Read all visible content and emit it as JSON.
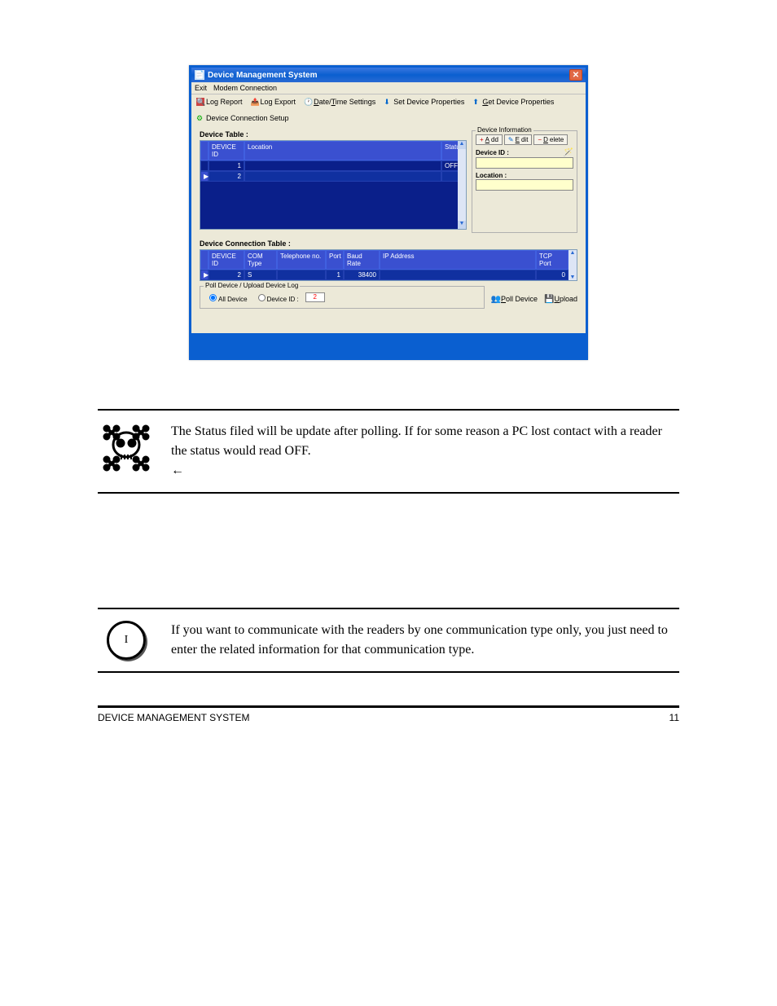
{
  "window": {
    "title": "Device Management System",
    "menu": {
      "item1": "Exit",
      "item2": "Modem Connection"
    },
    "toolbar": {
      "log_report": "Log Report",
      "log_export": "Log Export",
      "date_time": "Date/Time Settings",
      "set_props": "Set Device Properties",
      "get_props": "Get Device Properties",
      "conn_setup": "Device Connection Setup"
    },
    "device_table": {
      "label": "Device Table :",
      "headers": {
        "id": "DEVICE ID",
        "location": "Location",
        "status": "Status"
      },
      "rows": [
        {
          "id": "1",
          "status": "OFF"
        },
        {
          "id": "2",
          "status": ""
        }
      ]
    },
    "device_info": {
      "legend": "Device Information",
      "add": "Add",
      "edit": "Edit",
      "delete": "Delete",
      "id_label": "Device ID :",
      "loc_label": "Location :"
    },
    "conn_table": {
      "label": "Device Connection Table :",
      "headers": {
        "id": "DEVICE ID",
        "com": "COM Type",
        "tel": "Telephone no.",
        "port": "Port",
        "baud": "Baud Rate",
        "ip": "IP Address",
        "tcp": "TCP Port"
      },
      "row": {
        "id": "2",
        "com": "S",
        "port": "1",
        "baud": "38400",
        "tcp": "0"
      }
    },
    "poll": {
      "legend": "Poll Device / Upload Device Log",
      "all": "All Device",
      "did": "Device ID :",
      "did_val": "2",
      "poll_btn": "Poll Device",
      "upload_btn": "Upload"
    }
  },
  "notes": {
    "skull_text": "The Status filed will be update after polling. If for some reason a PC lost contact with a reader the status would read OFF.",
    "circle_letter": "I",
    "circle_text": "If you want to communicate with the readers by one communication type only, you just need to enter the related information for that communication type."
  },
  "footer": {
    "left": "DEVICE MANAGEMENT SYSTEM",
    "right": "11"
  }
}
